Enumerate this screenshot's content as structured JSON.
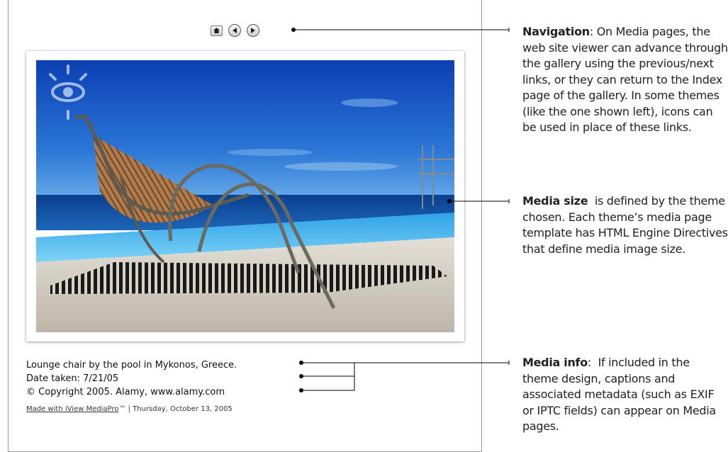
{
  "navigation": {
    "home_icon": "home-icon",
    "previous_icon": "arrow-left-icon",
    "next_icon": "arrow-right-icon"
  },
  "photo": {
    "alt": "Lounge chair by the pool in Mykonos, Greece."
  },
  "caption": {
    "line1": "Lounge chair by the pool in Mykonos, Greece.",
    "line2": "Date taken: 7/21/05",
    "line3": "© Copyright 2005. Alamy, www.alamy.com"
  },
  "footer": {
    "link_text": "Made with iView MediaPro",
    "trademark": "™",
    "separator": " | ",
    "date": "Thursday, October 13, 2005"
  },
  "annotations": {
    "navigation": {
      "title": "Navigation",
      "text": ": On Media pages, the web site viewer can advance through the gallery using the previous/next links, or they can return to the Index page of the gallery. In some themes (like the one shown left), icons can be used in place of these links."
    },
    "media_size": {
      "title": "Media size",
      "text": "  is defined by the theme chosen. Each theme’s media page template has HTML Engine Directives that define media image size."
    },
    "media_info": {
      "title": "Media info",
      "text": ":  If included in the theme design, captions and associated metadata (such as EXIF or IPTC fields) can appear on Media pages."
    }
  }
}
